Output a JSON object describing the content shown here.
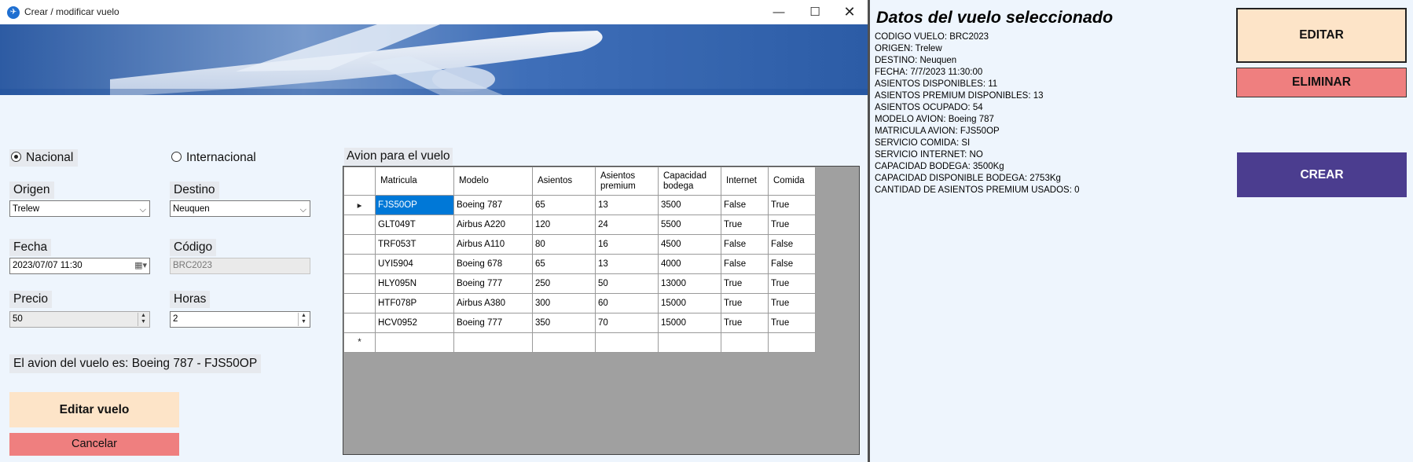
{
  "window": {
    "title": "Crear / modificar vuelo"
  },
  "form": {
    "tipo_vuelo": {
      "nacional": "Nacional",
      "internacional": "Internacional",
      "selected": "Nacional"
    },
    "origen": {
      "label": "Origen",
      "value": "Trelew"
    },
    "destino": {
      "label": "Destino",
      "value": "Neuquen"
    },
    "fecha": {
      "label": "Fecha",
      "value": "2023/07/07 11:30"
    },
    "codigo": {
      "label": "Código",
      "value": "BRC2023"
    },
    "precio": {
      "label": "Precio",
      "value": "50"
    },
    "horas": {
      "label": "Horas",
      "value": "2"
    },
    "avion_msg": "El avion del vuelo es: Boeing 787 - FJS50OP",
    "btn_editar_vuelo": "Editar vuelo",
    "btn_cancelar": "Cancelar"
  },
  "grid": {
    "title": "Avion para el vuelo",
    "columns": [
      "Matricula",
      "Modelo",
      "Asientos",
      "Asientos premium",
      "Capacidad bodega",
      "Internet",
      "Comida"
    ],
    "column_lines": [
      [
        "Matricula"
      ],
      [
        "Modelo"
      ],
      [
        "Asientos"
      ],
      [
        "Asientos",
        "premium"
      ],
      [
        "Capacidad",
        "bodega"
      ],
      [
        "Internet"
      ],
      [
        "Comida"
      ]
    ],
    "rows": [
      [
        "FJS50OP",
        "Boeing 787",
        "65",
        "13",
        "3500",
        "False",
        "True"
      ],
      [
        "GLT049T",
        "Airbus A220",
        "120",
        "24",
        "5500",
        "True",
        "True"
      ],
      [
        "TRF053T",
        "Airbus A110",
        "80",
        "16",
        "4500",
        "False",
        "False"
      ],
      [
        "UYI5904",
        "Boeing 678",
        "65",
        "13",
        "4000",
        "False",
        "False"
      ],
      [
        "HLY095N",
        "Boeing 777",
        "250",
        "50",
        "13000",
        "True",
        "True"
      ],
      [
        "HTF078P",
        "Airbus A380",
        "300",
        "60",
        "15000",
        "True",
        "True"
      ],
      [
        "HCV0952",
        "Boeing 777",
        "350",
        "70",
        "15000",
        "True",
        "True"
      ]
    ],
    "selected_row": 0,
    "new_row_marker": "*",
    "current_row_marker": "▸"
  },
  "details": {
    "title": "Datos del vuelo seleccionado",
    "lines": [
      "CODIGO VUELO: BRC2023",
      "ORIGEN: Trelew",
      "DESTINO: Neuquen",
      "FECHA: 7/7/2023 11:30:00",
      "ASIENTOS DISPONIBLES: 11",
      "ASIENTOS PREMIUM DISPONIBLES: 13",
      "ASIENTOS OCUPADO: 54",
      "MODELO AVION: Boeing 787",
      "MATRICULA AVION: FJS50OP",
      "SERVICIO COMIDA: SI",
      "SERVICIO INTERNET: NO",
      "CAPACIDAD BODEGA: 3500Kg",
      "CAPACIDAD DISPONIBLE BODEGA: 2753Kg",
      "CANTIDAD DE ASIENTOS PREMIUM USADOS: 0"
    ],
    "btn_editar": "EDITAR",
    "btn_eliminar": "ELIMINAR",
    "btn_crear": "CREAR"
  }
}
